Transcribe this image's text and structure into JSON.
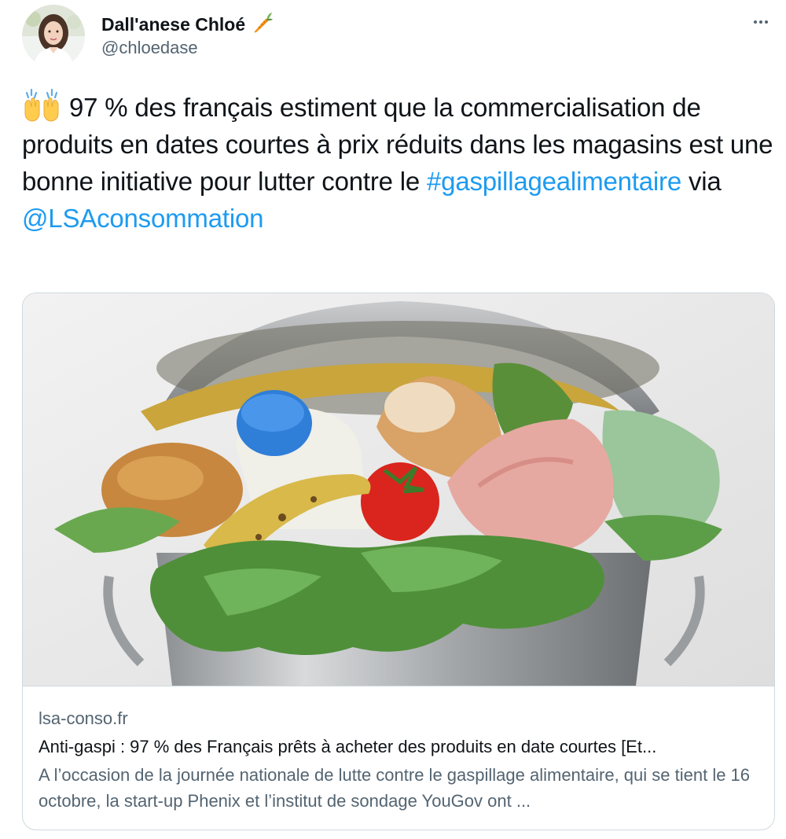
{
  "author": {
    "display_name": "Dall'anese Chloé",
    "name_emoji": "carrot-icon",
    "handle": "@chloedase"
  },
  "tweet": {
    "emoji": "raising-hands-icon",
    "text_part1": "97 % des français estiment que la commercialisation de produits en dates courtes à prix réduits dans les magasins est une bonne initiative pour lutter contre le ",
    "hashtag": "#gaspillagealimentaire",
    "text_part2": " via ",
    "mention": "@LSAconsommation"
  },
  "card": {
    "image": "food-waste-trash-can-image",
    "domain": "lsa-conso.fr",
    "title": "Anti-gaspi : 97 % des Français prêts à acheter des produits en date courtes [Et...",
    "description": "A l’occasion de la journée nationale de lutte contre le gaspillage alimentaire, qui se tient le 16 octobre, la start-up Phenix et l’institut de sondage YouGov ont ..."
  },
  "colors": {
    "link": "#1d9bf0",
    "secondary_text": "#536471",
    "border": "#cfd9de"
  }
}
